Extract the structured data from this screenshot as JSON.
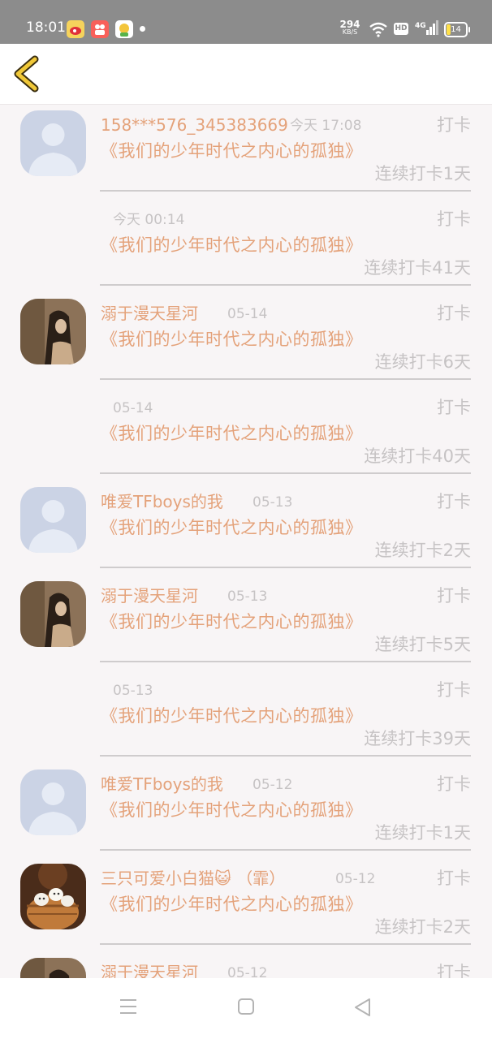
{
  "status_bar": {
    "time": "18:01",
    "net_speed": "294",
    "net_unit": "KB/S",
    "hd": "HD",
    "network": "4G",
    "battery": "14",
    "icons": [
      "weibo-app-icon",
      "video-app-icon",
      "kid-app-icon",
      "wifi-icon",
      "battery-icon"
    ]
  },
  "header": {
    "back_icon": "chevron-left-icon",
    "accent_color": "#f0c838"
  },
  "list": {
    "label_checkin": "打卡",
    "items": [
      {
        "name": "158***576_345383669",
        "time": "今天  17:08",
        "book": "《我们的少年时代之内心的孤独》",
        "streak": "连续打卡1天",
        "avatar": "default"
      },
      {
        "name": "",
        "time": "今天  00:14",
        "book": "《我们的少年时代之内心的孤独》",
        "streak": "连续打卡41天",
        "avatar": "none"
      },
      {
        "name": "溺于漫天星河",
        "time": "05-14",
        "book": "《我们的少年时代之内心的孤独》",
        "streak": "连续打卡6天",
        "avatar": "girl"
      },
      {
        "name": "",
        "time": "05-14",
        "book": "《我们的少年时代之内心的孤独》",
        "streak": "连续打卡40天",
        "avatar": "none"
      },
      {
        "name": "唯爱TFboys的我",
        "time": "05-13",
        "book": "《我们的少年时代之内心的孤独》",
        "streak": "连续打卡2天",
        "avatar": "default"
      },
      {
        "name": "溺于漫天星河",
        "time": "05-13",
        "book": "《我们的少年时代之内心的孤独》",
        "streak": "连续打卡5天",
        "avatar": "girl"
      },
      {
        "name": "",
        "time": "05-13",
        "book": "《我们的少年时代之内心的孤独》",
        "streak": "连续打卡39天",
        "avatar": "none"
      },
      {
        "name": "唯爱TFboys的我",
        "time": "05-12",
        "book": "《我们的少年时代之内心的孤独》",
        "streak": "连续打卡1天",
        "avatar": "default"
      },
      {
        "name": "三只可爱小白猫😺 （霏）",
        "time": "05-12",
        "book": "《我们的少年时代之内心的孤独》",
        "streak": "连续打卡2天",
        "avatar": "cats"
      },
      {
        "name": "溺于漫天星河",
        "time": "05-12",
        "book": "",
        "streak": "",
        "avatar": "girl"
      }
    ]
  },
  "nav_bar": {
    "icons": [
      "menu-icon",
      "home-square-icon",
      "back-triangle-icon"
    ]
  },
  "colors": {
    "name_text": "#e4a27a",
    "muted_text": "#c6c3c4",
    "status_bar": "#8c8c8c",
    "page_bg": "#f8f5f6"
  }
}
